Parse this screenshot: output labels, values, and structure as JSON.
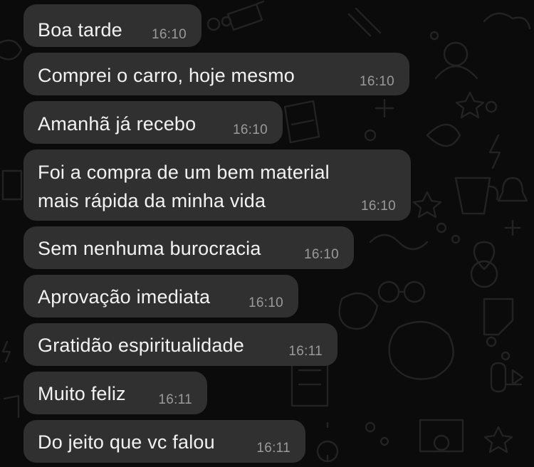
{
  "messages": [
    {
      "text": "Boa tarde",
      "time": "16:10"
    },
    {
      "text": "Comprei o carro, hoje mesmo",
      "time": "16:10"
    },
    {
      "text": "Amanhã já recebo",
      "time": "16:10"
    },
    {
      "text": "Foi a compra de um bem material\nmais rápida da minha vida",
      "time": "16:10"
    },
    {
      "text": "Sem nenhuma burocracia",
      "time": "16:10"
    },
    {
      "text": "Aprovação imediata",
      "time": "16:10"
    },
    {
      "text": "Gratidão espiritualidade",
      "time": "16:11"
    },
    {
      "text": "Muito feliz",
      "time": "16:11"
    },
    {
      "text": "Do jeito que vc falou",
      "time": "16:11"
    }
  ],
  "theme": {
    "background": "#0b0b0b",
    "bubble": "#303030",
    "text": "#f2f2f2",
    "time": "#9a9a9a"
  }
}
